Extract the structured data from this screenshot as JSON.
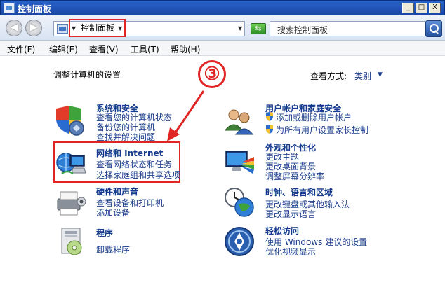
{
  "window": {
    "title": "控制面板",
    "controls": [
      "_",
      "□",
      "X"
    ]
  },
  "address": {
    "breadcrumb": "控制面板",
    "search_placeholder": "搜索控制面板"
  },
  "menu": [
    "文件(F)",
    "编辑(E)",
    "查看(V)",
    "工具(T)",
    "帮助(H)"
  ],
  "content": {
    "heading": "调整计算机的设置",
    "view_by_label": "查看方式:",
    "view_by_value": "类别",
    "step_marker": "③"
  },
  "categories": [
    {
      "title": "系统和安全",
      "links": [
        "查看您的计算机状态",
        "备份您的计算机",
        "查找并解决问题"
      ],
      "icon": "system-security-icon"
    },
    {
      "title": "网络和 Internet",
      "links": [
        "查看网络状态和任务",
        "选择家庭组和共享选项"
      ],
      "icon": "network-icon"
    },
    {
      "title": "硬件和声音",
      "links": [
        "查看设备和打印机",
        "添加设备"
      ],
      "icon": "hardware-sound-icon"
    },
    {
      "title": "程序",
      "links": [
        "卸载程序"
      ],
      "icon": "programs-icon"
    },
    {
      "title": "用户帐户和家庭安全",
      "links": [
        "添加或删除用户帐户",
        "为所有用户设置家长控制"
      ],
      "icon": "users-icon"
    },
    {
      "title": "外观和个性化",
      "links": [
        "更改主题",
        "更改桌面背景",
        "调整屏幕分辨率"
      ],
      "icon": "appearance-icon"
    },
    {
      "title": "时钟、语言和区域",
      "links": [
        "更改键盘或其他输入法",
        "更改显示语言"
      ],
      "icon": "clock-globe-icon"
    },
    {
      "title": "轻松访问",
      "links": [
        "使用 Windows 建议的设置",
        "优化视频显示"
      ],
      "icon": "ease-of-access-icon"
    }
  ],
  "colors": {
    "annotation_red": "#e02525",
    "link_blue": "#1a3c8c",
    "title_bar": "#1a47a8"
  }
}
